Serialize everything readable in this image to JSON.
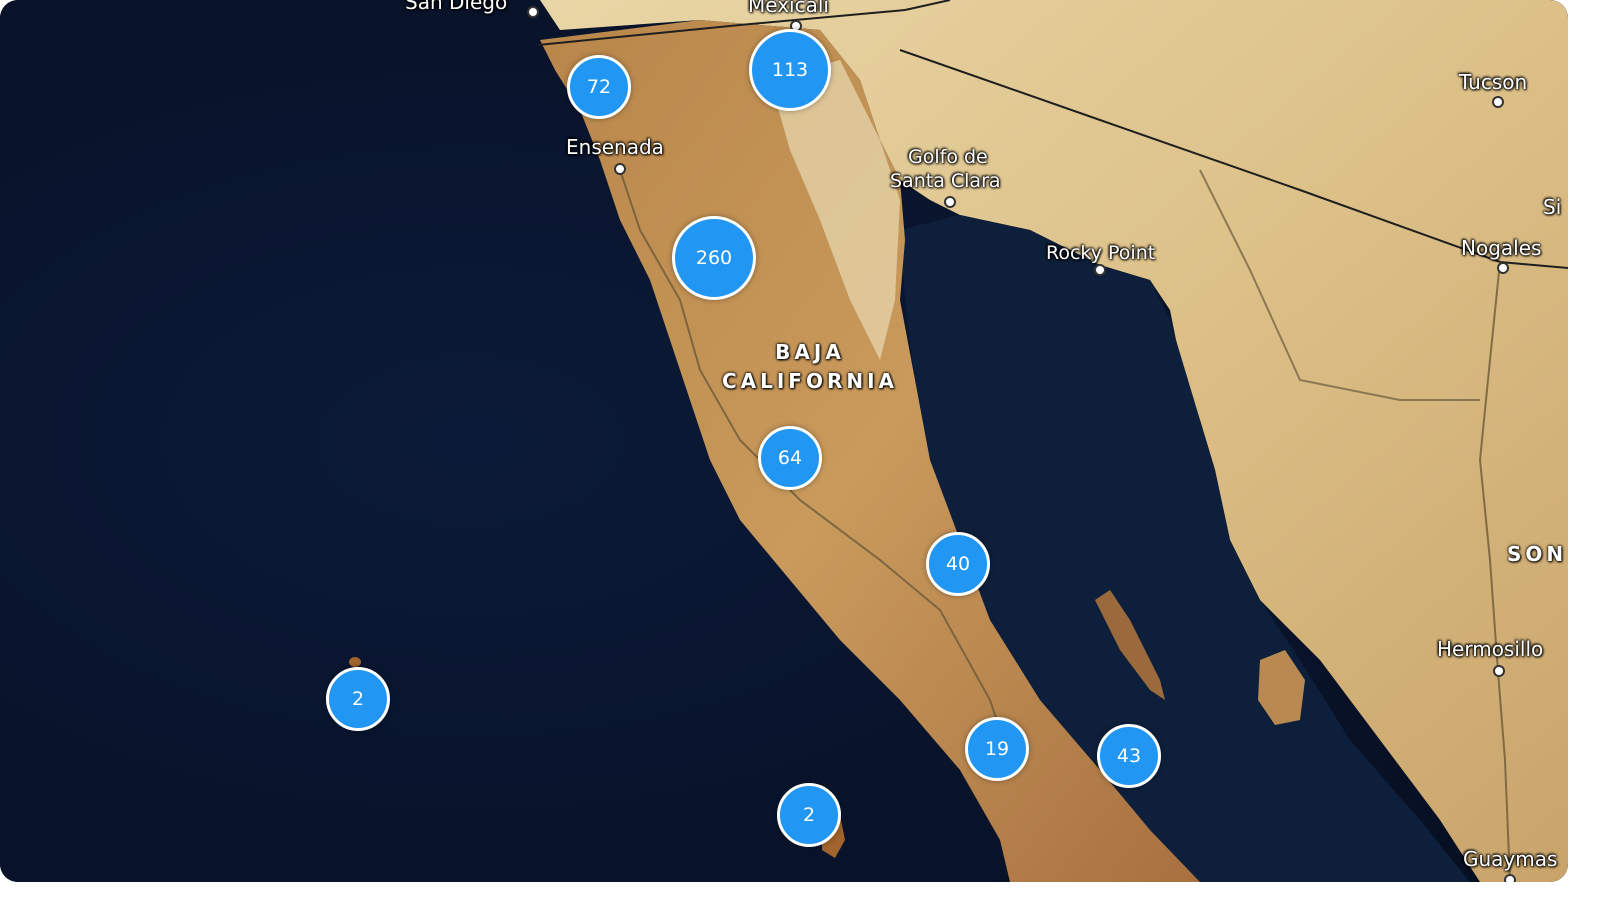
{
  "map": {
    "style": "satellite",
    "colors": {
      "ocean": "#0b1730",
      "land_light": "#e6d3a2",
      "land_mid": "#c79a5a",
      "land_dark": "#8a5a2c",
      "cluster_fill": "#2196f3",
      "cluster_border": "#ffffff",
      "border_line": "#1f1f1f"
    }
  },
  "places": {
    "san_diego": "San Diego",
    "mexicali": "Mexicali",
    "tucson": "Tucson",
    "ensenada": "Ensenada",
    "golfo_de_santa_clara": [
      "Golfo de",
      "Santa Clara"
    ],
    "rocky_point": "Rocky Point",
    "nogales": "Nogales",
    "sierra_vista_partial": "Si",
    "hermosillo": "Hermosillo",
    "guaymas": "Guaymas"
  },
  "regions": {
    "baja_california": [
      "BAJA",
      "CALIFORNIA"
    ],
    "sonora_partial": "SON"
  },
  "clusters": [
    {
      "id": "c72",
      "count": "72"
    },
    {
      "id": "c113",
      "count": "113"
    },
    {
      "id": "c260",
      "count": "260"
    },
    {
      "id": "c64",
      "count": "64"
    },
    {
      "id": "c40",
      "count": "40"
    },
    {
      "id": "c2a",
      "count": "2"
    },
    {
      "id": "c19",
      "count": "19"
    },
    {
      "id": "c43",
      "count": "43"
    },
    {
      "id": "c2b",
      "count": "2"
    }
  ]
}
